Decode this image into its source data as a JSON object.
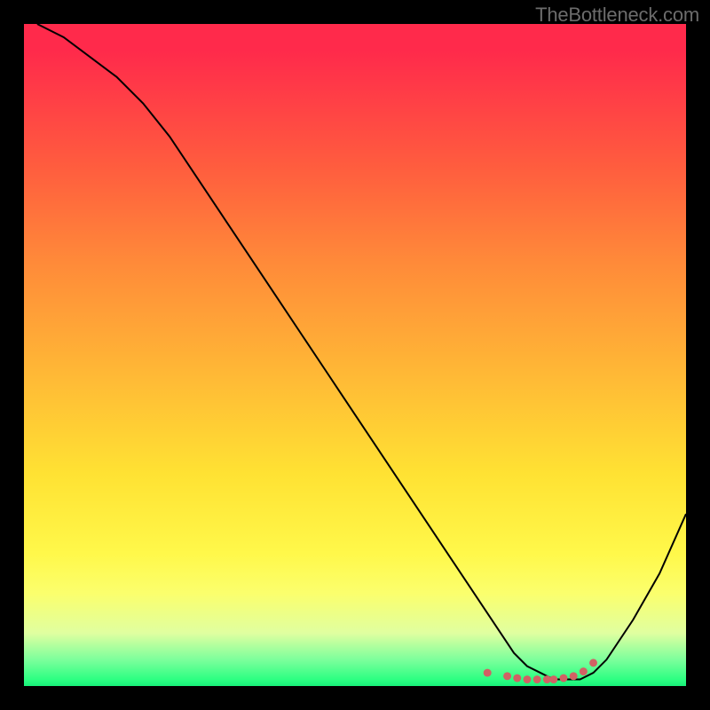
{
  "attribution": "TheBottleneck.com",
  "colors": {
    "curve_stroke": "#000000",
    "dot_fill": "#d16164",
    "background": "#000000"
  },
  "chart_data": {
    "type": "line",
    "title": "",
    "xlabel": "",
    "ylabel": "",
    "xlim": [
      0,
      100
    ],
    "ylim": [
      0,
      100
    ],
    "series": [
      {
        "name": "bottleneck-curve",
        "x": [
          2,
          6,
          10,
          14,
          18,
          22,
          26,
          30,
          34,
          38,
          42,
          46,
          50,
          54,
          58,
          62,
          66,
          70,
          72,
          74,
          76,
          78,
          80,
          82,
          84,
          86,
          88,
          92,
          96,
          100
        ],
        "y": [
          100,
          98,
          95,
          92,
          88,
          83,
          77,
          71,
          65,
          59,
          53,
          47,
          41,
          35,
          29,
          23,
          17,
          11,
          8,
          5,
          3,
          2,
          1,
          1,
          1,
          2,
          4,
          10,
          17,
          26
        ]
      }
    ],
    "flat_region_markers": {
      "name": "low-bottleneck-dots",
      "x": [
        70,
        73,
        74.5,
        76,
        77.5,
        79,
        80,
        81.5,
        83,
        84.5,
        86
      ],
      "y": [
        2,
        1.5,
        1.2,
        1,
        1,
        1,
        1,
        1.2,
        1.5,
        2.2,
        3.5
      ]
    }
  }
}
